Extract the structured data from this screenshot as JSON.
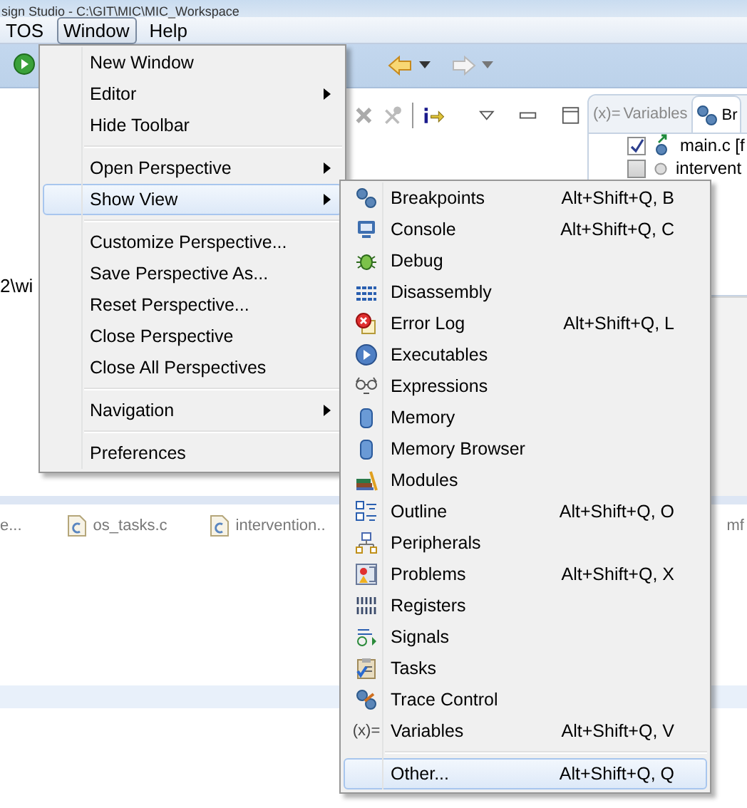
{
  "window": {
    "title": "sign Studio - C:\\GIT\\MIC\\MIC_Workspace"
  },
  "menubar": [
    {
      "label": "TOS",
      "selected": false
    },
    {
      "label": "Window",
      "selected": true
    },
    {
      "label": "Help",
      "selected": false
    }
  ],
  "left_panel": {
    "text": "2\\wi"
  },
  "right_panel": {
    "tabs": [
      {
        "icon_text": "(x)=",
        "label": "Variables",
        "selected": false
      },
      {
        "label": "Br",
        "selected": true
      }
    ],
    "rows": [
      {
        "label": "main.c [f",
        "checked": true
      },
      {
        "label": "intervent",
        "checked": false
      }
    ]
  },
  "editor_tabs": [
    {
      "label": "e..."
    },
    {
      "label": "os_tasks.c"
    },
    {
      "label": "intervention.."
    },
    {
      "label": "mf"
    }
  ],
  "window_menu": {
    "items": [
      {
        "kind": "item",
        "label": "New Window",
        "submenu": false,
        "selected": false
      },
      {
        "kind": "item",
        "label": "Editor",
        "submenu": true,
        "selected": false
      },
      {
        "kind": "item",
        "label": "Hide Toolbar",
        "submenu": false,
        "selected": false
      },
      {
        "kind": "separator"
      },
      {
        "kind": "item",
        "label": "Open Perspective",
        "submenu": true,
        "selected": false
      },
      {
        "kind": "item",
        "label": "Show View",
        "submenu": true,
        "selected": true
      },
      {
        "kind": "separator"
      },
      {
        "kind": "item",
        "label": "Customize Perspective...",
        "submenu": false,
        "selected": false
      },
      {
        "kind": "item",
        "label": "Save Perspective As...",
        "submenu": false,
        "selected": false
      },
      {
        "kind": "item",
        "label": "Reset Perspective...",
        "submenu": false,
        "selected": false
      },
      {
        "kind": "item",
        "label": "Close Perspective",
        "submenu": false,
        "selected": false
      },
      {
        "kind": "item",
        "label": "Close All Perspectives",
        "submenu": false,
        "selected": false
      },
      {
        "kind": "separator"
      },
      {
        "kind": "item",
        "label": "Navigation",
        "submenu": true,
        "selected": false
      },
      {
        "kind": "separator"
      },
      {
        "kind": "item",
        "label": "Preferences",
        "submenu": false,
        "selected": false
      }
    ]
  },
  "show_view_menu": {
    "items": [
      {
        "kind": "item",
        "label": "Breakpoints",
        "shortcut": "Alt+Shift+Q, B",
        "selected": false
      },
      {
        "kind": "item",
        "label": "Console",
        "shortcut": "Alt+Shift+Q, C",
        "selected": false
      },
      {
        "kind": "item",
        "label": "Debug",
        "selected": false
      },
      {
        "kind": "item",
        "label": "Disassembly",
        "selected": false
      },
      {
        "kind": "item",
        "label": "Error Log",
        "shortcut": "Alt+Shift+Q, L",
        "selected": false
      },
      {
        "kind": "item",
        "label": "Executables",
        "selected": false
      },
      {
        "kind": "item",
        "label": "Expressions",
        "selected": false
      },
      {
        "kind": "item",
        "label": "Memory",
        "selected": false
      },
      {
        "kind": "item",
        "label": "Memory Browser",
        "selected": false
      },
      {
        "kind": "item",
        "label": "Modules",
        "selected": false
      },
      {
        "kind": "item",
        "label": "Outline",
        "shortcut": "Alt+Shift+Q, O",
        "selected": false
      },
      {
        "kind": "item",
        "label": "Peripherals",
        "selected": false
      },
      {
        "kind": "item",
        "label": "Problems",
        "shortcut": "Alt+Shift+Q, X",
        "selected": false
      },
      {
        "kind": "item",
        "label": "Registers",
        "selected": false
      },
      {
        "kind": "item",
        "label": "Signals",
        "selected": false
      },
      {
        "kind": "item",
        "label": "Tasks",
        "selected": false
      },
      {
        "kind": "item",
        "label": "Trace Control",
        "selected": false
      },
      {
        "kind": "item",
        "label": "Variables",
        "icon_text": "(x)=",
        "shortcut": "Alt+Shift+Q, V",
        "selected": false
      },
      {
        "kind": "separator"
      },
      {
        "kind": "item",
        "label": "Other...",
        "shortcut": "Alt+Shift+Q, Q",
        "selected": true
      }
    ]
  }
}
